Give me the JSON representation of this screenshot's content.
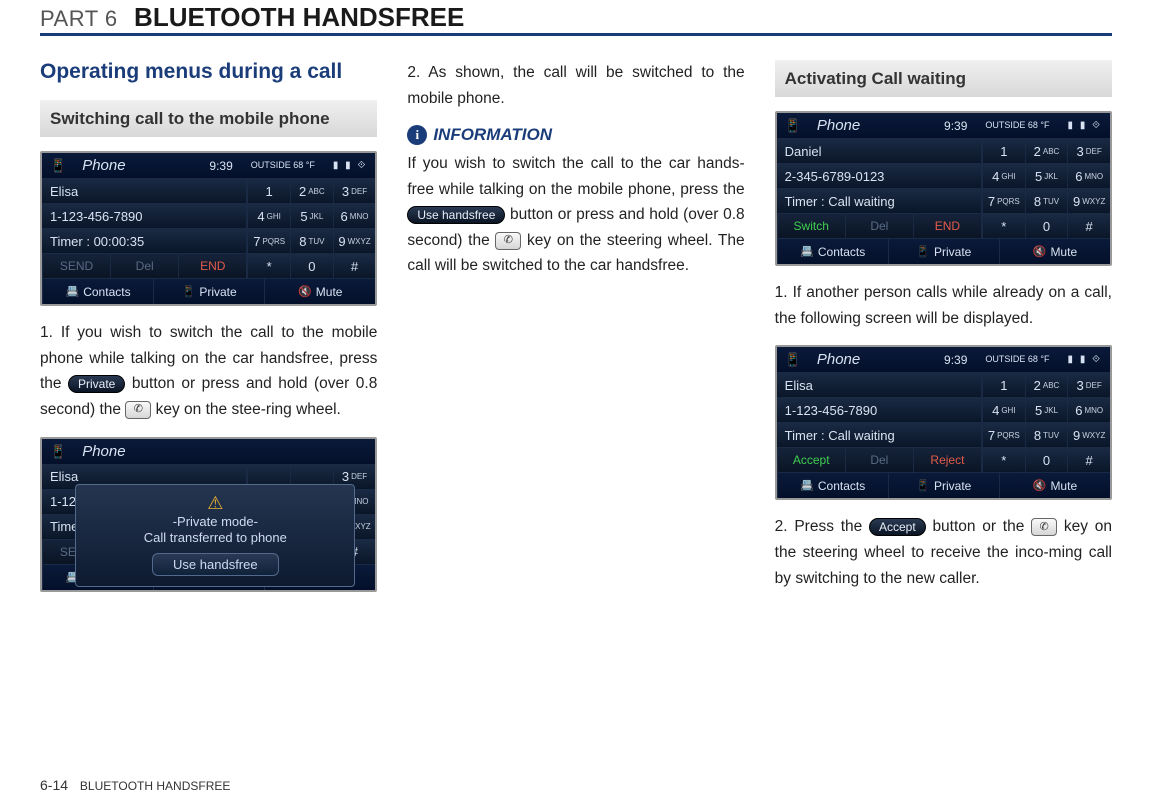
{
  "header": {
    "part": "PART 6",
    "title": "BLUETOOTH HANDSFREE"
  },
  "footer": {
    "page": "6-14",
    "section": "BLUETOOTH HANDSFREE"
  },
  "col1": {
    "section_title": "Operating menus during a call",
    "sub1": "Switching call to the mobile phone",
    "shot1": {
      "app": "Phone",
      "time": "9:39",
      "temp": "OUTSIDE 68 °F",
      "r1": "Elisa",
      "r2": "1-123-456-7890",
      "r3": "Timer : 00:00:35",
      "act1": "SEND",
      "act2": "Del",
      "act3": "END",
      "foot1": "Contacts",
      "foot2": "Private",
      "foot3": "Mute"
    },
    "p1_a": "1. If you wish to switch the call to the mobile phone while talking on the car handsfree, press the ",
    "p1_btn": "Private",
    "p1_b": " button or press and hold (over 0.8 second) the ",
    "p1_c": " key on the stee-ring wheel.",
    "shot2": {
      "app": "Phone",
      "r1": "Elisa",
      "r2": "1-123-",
      "r3": "Timer",
      "act1": "SEND",
      "pop1": "-Private mode-",
      "pop2": "Call transferred to phone",
      "popbtn": "Use handsfree",
      "foot1": "Contacts",
      "foot2": "Private",
      "foot3": "Mute"
    }
  },
  "col2": {
    "p2": "2. As shown, the call will be switched to the mobile phone.",
    "info_label": "INFORMATION",
    "info_a": "If you wish to switch the call to the car hands-free while talking on the mobile phone, press the ",
    "info_btn": "Use handsfree",
    "info_b": " button or press and hold (over 0.8 second) the ",
    "info_c": " key on the steering wheel. The call will be switched to the car handsfree."
  },
  "col3": {
    "sub": "Activating Call waiting",
    "shotA": {
      "app": "Phone",
      "time": "9:39",
      "temp": "OUTSIDE 68 °F",
      "r1": "Daniel",
      "r2": "2-345-6789-0123",
      "r3": "Timer : Call waiting",
      "act1": "Switch",
      "act2": "Del",
      "act3": "END",
      "foot1": "Contacts",
      "foot2": "Private",
      "foot3": "Mute"
    },
    "pA": "1. If another person calls while already on a call, the following screen will be displayed.",
    "shotB": {
      "app": "Phone",
      "time": "9:39",
      "temp": "OUTSIDE 68 °F",
      "r1": "Elisa",
      "r2": "1-123-456-7890",
      "r3": "Timer : Call waiting",
      "act1": "Accept",
      "act2": "Del",
      "act3": "Reject",
      "foot1": "Contacts",
      "foot2": "Private",
      "foot3": "Mute"
    },
    "pB_a": "2. Press the ",
    "pB_btn": "Accept",
    "pB_b": " button or the ",
    "pB_c": " key on the steering wheel to receive the inco-ming call by switching to the new caller."
  },
  "keypad": {
    "k1": "1",
    "k2n": "2",
    "k2l": "ABC",
    "k3n": "3",
    "k3l": "DEF",
    "k4n": "4",
    "k4l": "GHI",
    "k5n": "5",
    "k5l": "JKL",
    "k6n": "6",
    "k6l": "MNO",
    "k7n": "7",
    "k7l": "PQRS",
    "k8n": "8",
    "k8l": "TUV",
    "k9n": "9",
    "k9l": "WXYZ",
    "ks": "*",
    "k0": "0",
    "kp": "#"
  }
}
